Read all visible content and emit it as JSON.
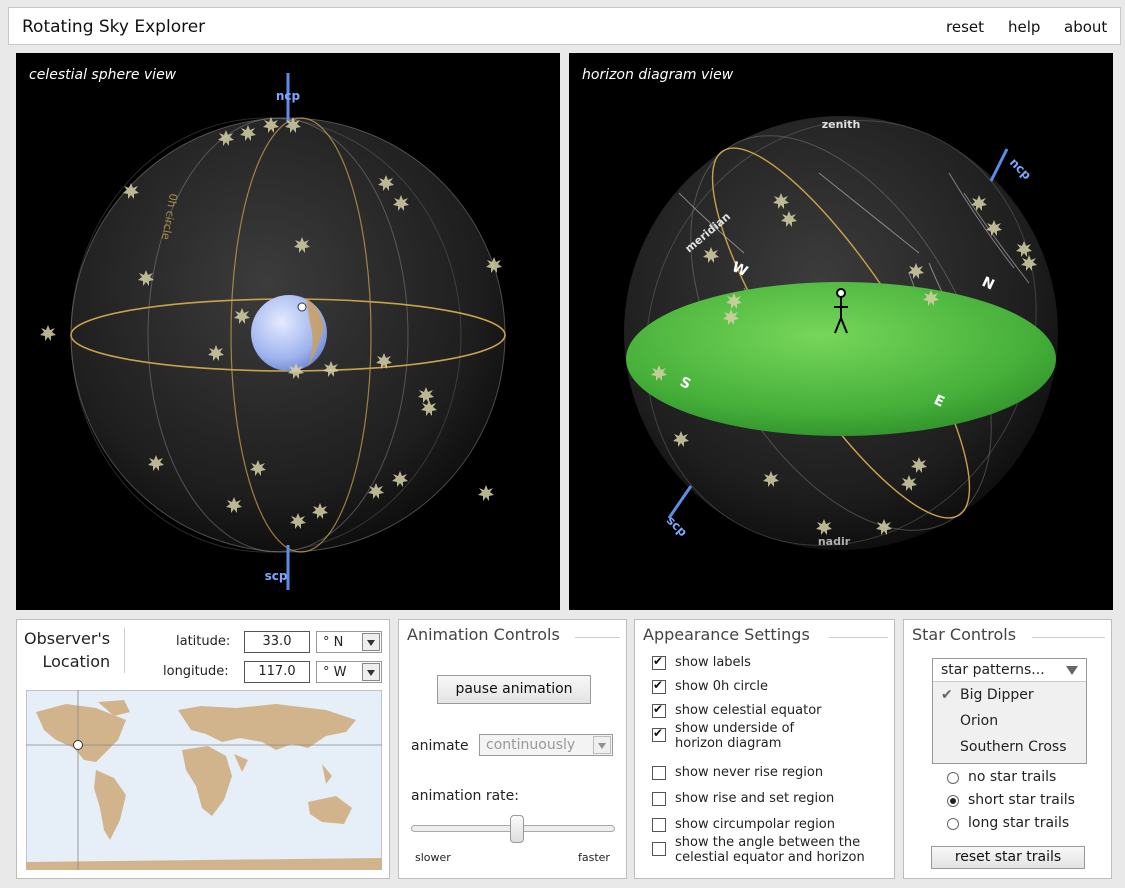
{
  "app": {
    "title": "Rotating Sky Explorer"
  },
  "menu": {
    "reset": "reset",
    "help": "help",
    "about": "about"
  },
  "celestial_view": {
    "label": "celestial sphere view",
    "ncp": "ncp",
    "scp": "scp",
    "circle_label": "0h circle"
  },
  "horizon_view": {
    "label": "horizon diagram view",
    "zenith": "zenith",
    "nadir": "nadir",
    "ncp": "ncp",
    "scp": "scp",
    "meridian": "meridian",
    "dir_n": "N",
    "dir_s": "S",
    "dir_e": "E",
    "dir_w": "W"
  },
  "observer": {
    "title_line1": "Observer's",
    "title_line2": "Location",
    "latitude_label": "latitude:",
    "latitude_value": "33.0",
    "latitude_dir": "° N",
    "longitude_label": "longitude:",
    "longitude_value": "117.0",
    "longitude_dir": "° W"
  },
  "animation": {
    "title": "Animation Controls",
    "pause_label": "pause animation",
    "animate_label": "animate",
    "animate_value": "continuously",
    "rate_label": "animation rate:",
    "slower": "slower",
    "faster": "faster",
    "rate": 0.52
  },
  "appearance": {
    "title": "Appearance Settings",
    "options": [
      {
        "label": "show labels",
        "checked": true
      },
      {
        "label": "show 0h circle",
        "checked": true
      },
      {
        "label": "show celestial equator",
        "checked": true
      },
      {
        "label": "show underside of horizon diagram",
        "checked": true
      },
      {
        "label": "show never rise region",
        "checked": false
      },
      {
        "label": "show rise and set region",
        "checked": false
      },
      {
        "label": "show circumpolar region",
        "checked": false
      },
      {
        "label": "show the angle between the celestial equator and horizon",
        "checked": false
      }
    ]
  },
  "stars": {
    "title": "Star Controls",
    "patterns_label": "star patterns...",
    "patterns": [
      {
        "label": "Big Dipper",
        "checked": true
      },
      {
        "label": "Orion",
        "checked": false
      },
      {
        "label": "Southern Cross",
        "checked": false
      }
    ],
    "trails": [
      {
        "label": "no star trails",
        "selected": false
      },
      {
        "label": "short star trails",
        "selected": true
      },
      {
        "label": "long star trails",
        "selected": false
      }
    ],
    "reset_label": "reset star trails"
  },
  "colors": {
    "accent_blue": "#5b8ee6",
    "horizon_green": "#3fa93f",
    "equator_gold": "#c9a24a",
    "land": "#d2b48c",
    "ocean": "#e6eef8"
  }
}
